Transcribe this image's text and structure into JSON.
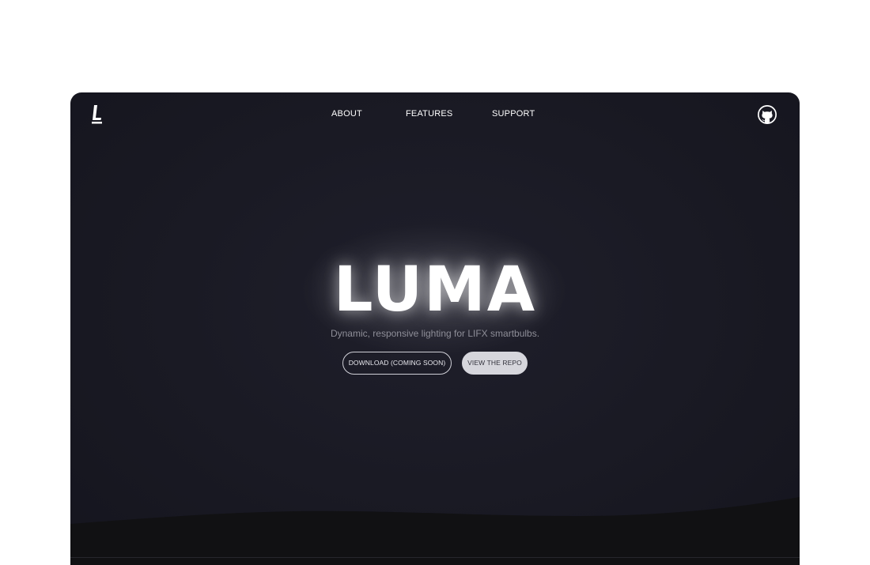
{
  "header": {
    "logo_icon": "letter-l-logo-icon",
    "nav": [
      {
        "label": "ABOUT"
      },
      {
        "label": "FEATURES"
      },
      {
        "label": "SUPPORT"
      }
    ],
    "github_icon": "github-icon"
  },
  "hero": {
    "title": "LUMA",
    "subtitle": "Dynamic, responsive lighting for LIFX smartbulbs.",
    "buttons": {
      "download": "DOWNLOAD (COMING SOON)",
      "repo": "VIEW THE REPO"
    }
  },
  "colors": {
    "background": "#1a1a24",
    "footer_wave": "#111113",
    "text": "#ffffff",
    "subtitle": "#8e8e98",
    "repo_button_bg": "#d6d6dc"
  }
}
